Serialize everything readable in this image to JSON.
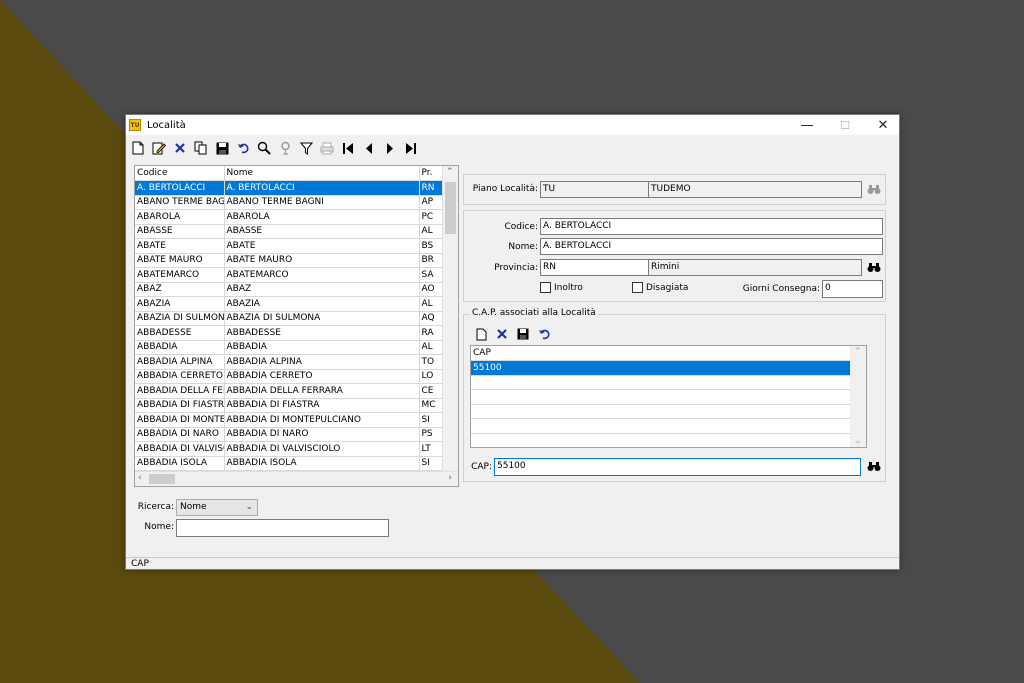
{
  "window": {
    "title": "Località",
    "app_icon_text": "TU",
    "minimize": "—",
    "maximize": "☐",
    "close": "✕"
  },
  "toolbar": {
    "icons": [
      "new-icon",
      "edit-icon",
      "delete-icon",
      "copy-icon",
      "save-icon",
      "undo-icon",
      "search-icon",
      "settings-icon",
      "filter-icon",
      "print-icon",
      "first-icon",
      "prev-icon",
      "next-icon",
      "last-icon"
    ]
  },
  "grid": {
    "columns": [
      "Codice",
      "Nome",
      "Pr."
    ],
    "rows": [
      [
        "A. BERTOLACCI",
        "A. BERTOLACCI",
        "RN"
      ],
      [
        "ABANO TERME BAGNI",
        "ABANO TERME BAGNI",
        "AP"
      ],
      [
        "ABAROLA",
        "ABAROLA",
        "PC"
      ],
      [
        "ABASSE",
        "ABASSE",
        "AL"
      ],
      [
        "ABATE",
        "ABATE",
        "BS"
      ],
      [
        "ABATE MAURO",
        "ABATE MAURO",
        "BR"
      ],
      [
        "ABATEMARCO",
        "ABATEMARCO",
        "SA"
      ],
      [
        "ABAZ",
        "ABAZ",
        "AO"
      ],
      [
        "ABAZIA",
        "ABAZIA",
        "AL"
      ],
      [
        "ABAZIA DI SULMONA",
        "ABAZIA DI SULMONA",
        "AQ"
      ],
      [
        "ABBADESSE",
        "ABBADESSE",
        "RA"
      ],
      [
        "ABBADIA",
        "ABBADIA",
        "AL"
      ],
      [
        "ABBADIA ALPINA",
        "ABBADIA ALPINA",
        "TO"
      ],
      [
        "ABBADIA CERRETO",
        "ABBADIA CERRETO",
        "LO"
      ],
      [
        "ABBADIA DELLA FERRARA",
        "ABBADIA DELLA FERRARA",
        "CE"
      ],
      [
        "ABBADIA DI FIASTRA",
        "ABBADIA DI FIASTRA",
        "MC"
      ],
      [
        "ABBADIA DI MONTEPULCIANO",
        "ABBADIA DI MONTEPULCIANO",
        "SI"
      ],
      [
        "ABBADIA DI NARO",
        "ABBADIA DI NARO",
        "PS"
      ],
      [
        "ABBADIA DI VALVISCIOLO",
        "ABBADIA DI VALVISCIOLO",
        "LT"
      ],
      [
        "ABBADIA ISOLA",
        "ABBADIA ISOLA",
        "SI"
      ]
    ],
    "selected_index": 0
  },
  "search": {
    "ricerca_label": "Ricerca:",
    "ricerca_value": "Nome",
    "nome_label": "Nome:",
    "nome_value": ""
  },
  "piano": {
    "label": "Piano Località:",
    "code": "TU",
    "name": "TUDEMO"
  },
  "detail": {
    "codice_label": "Codice:",
    "codice_value": "A. BERTOLACCI",
    "nome_label": "Nome:",
    "nome_value": "A. BERTOLACCI",
    "provincia_label": "Provincia:",
    "provincia_code": "RN",
    "provincia_name": "Rimini",
    "inoltro_label": "Inoltro",
    "disagiata_label": "Disagiata",
    "giorni_label": "Giorni Consegna:",
    "giorni_value": "0"
  },
  "cap_group": {
    "title": "C.A.P. associati alla Località",
    "column": "CAP",
    "rows": [
      "55100",
      "",
      "",
      "",
      "",
      ""
    ],
    "selected_index": 0,
    "cap_label": "CAP:",
    "cap_value": "55100"
  },
  "status": {
    "text": "CAP"
  },
  "colors": {
    "selection": "#0078d7",
    "background_dark": "#4a4a4a",
    "background_olive": "#5a4a0e"
  }
}
